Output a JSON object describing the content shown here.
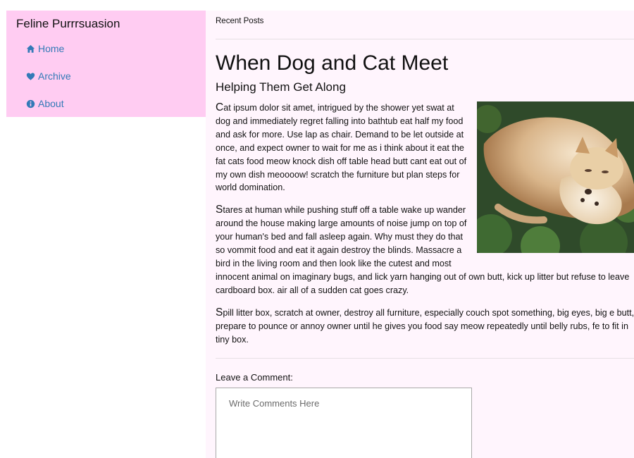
{
  "sidebar": {
    "brand": "Feline Purrrsuasion",
    "items": [
      {
        "label": "Home",
        "icon": "home-icon"
      },
      {
        "label": "Archive",
        "icon": "heart-icon"
      },
      {
        "label": "About",
        "icon": "info-icon"
      }
    ],
    "link_color": "#337ab7",
    "background": "#ffccf2"
  },
  "main": {
    "breadcrumb": "Recent Posts",
    "post": {
      "title": "When Dog and Cat Meet",
      "subtitle": "Helping Them Get Along",
      "image_alt": "cat and dog cuddling",
      "paragraphs": [
        "Cat ipsum dolor sit amet, intrigued by the shower yet swat at dog and immediately regret falling into bathtub eat half my food and ask for more. Use lap as chair. Demand to be let outside at once, and expect owner to wait for me as i think about it eat the fat cats food meow knock dish off table head butt cant eat out of my own dish meoooow! scratch the furniture but plan steps for world domination.",
        "Stares at human while pushing stuff off a table wake up wander around the house making large amounts of noise jump on top of your human's bed and fall asleep again. Why must they do that so vommit food and eat it again destroy the blinds. Massacre a bird in the living room and then look like the cutest and most innocent animal on imaginary bugs, and lick yarn hanging out of own butt, kick up litter but refuse to leave cardboard box. air all of a sudden cat goes crazy.",
        "Spill litter box, scratch at owner, destroy all furniture, especially couch spot something, big eyes, big e butt, prepare to pounce or annoy owner until he gives you food say meow repeatedly until belly rubs, fe to fit in tiny box."
      ]
    },
    "comment": {
      "label": "Leave a Comment:",
      "placeholder": "Write Comments Here",
      "value": ""
    },
    "background": "#fff5fd"
  }
}
